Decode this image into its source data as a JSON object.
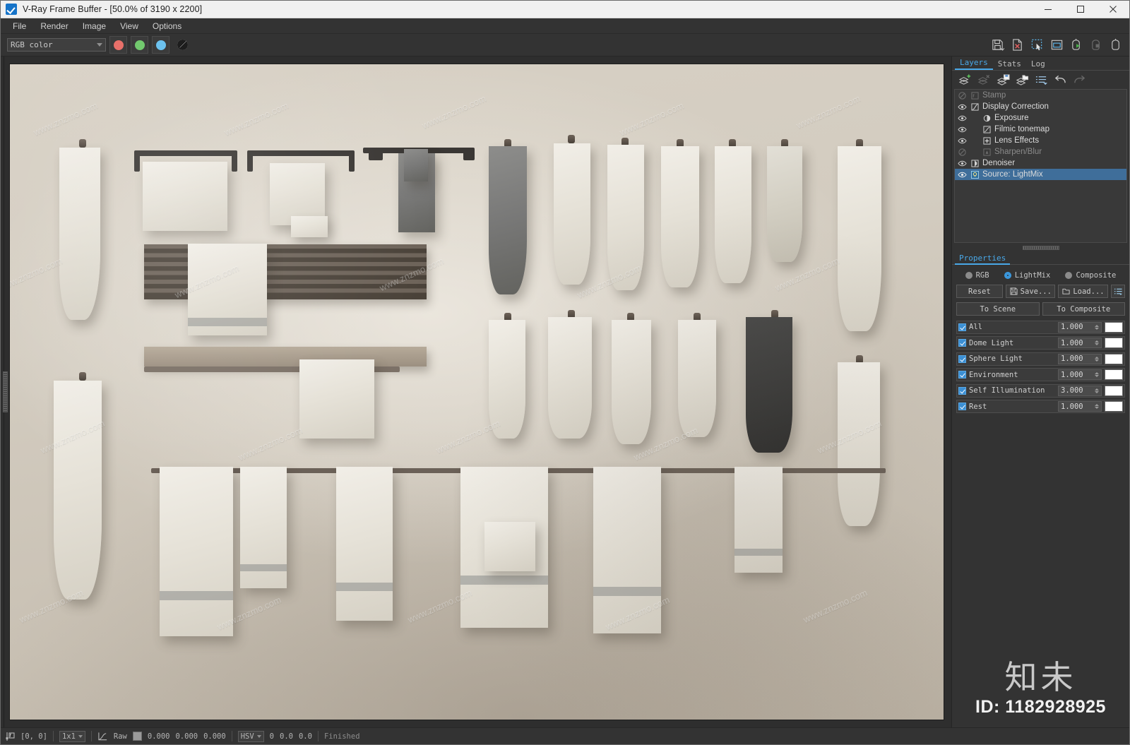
{
  "window": {
    "title": "V-Ray Frame Buffer - [50.0% of 3190 x 2200]",
    "app_icon": "vray-checkbox-icon",
    "minimize": "minimize-icon",
    "maximize": "maximize-icon",
    "close": "close-icon"
  },
  "menu": {
    "items": [
      {
        "label": "File"
      },
      {
        "label": "Render"
      },
      {
        "label": "Image"
      },
      {
        "label": "View"
      },
      {
        "label": "Options"
      }
    ]
  },
  "toolbar": {
    "channel_select": {
      "value": "RGB color"
    },
    "channels": [
      {
        "name": "red-channel-button",
        "color": "#e8706a"
      },
      {
        "name": "green-channel-button",
        "color": "#72c96e"
      },
      {
        "name": "blue-channel-button",
        "color": "#6cc2ef"
      }
    ],
    "alpha_button": "alpha-channel-button",
    "right_icons": [
      {
        "name": "save-image-icon",
        "enabled": true
      },
      {
        "name": "clear-image-icon",
        "enabled": true
      },
      {
        "name": "region-select-icon",
        "enabled": true
      },
      {
        "name": "show-in-window-icon",
        "enabled": true
      },
      {
        "name": "start-render-icon",
        "enabled": true
      },
      {
        "name": "stop-render-icon",
        "enabled": false
      },
      {
        "name": "render-last-icon",
        "enabled": true
      }
    ]
  },
  "layers_panel": {
    "tabs": [
      {
        "label": "Layers",
        "active": true
      },
      {
        "label": "Stats",
        "active": false
      },
      {
        "label": "Log",
        "active": false
      }
    ],
    "toolbar": [
      {
        "name": "add-layer-icon",
        "enabled": true
      },
      {
        "name": "delete-layer-icon",
        "enabled": false
      },
      {
        "name": "save-layers-icon",
        "enabled": true
      },
      {
        "name": "load-layers-icon",
        "enabled": true
      },
      {
        "name": "layer-presets-icon",
        "enabled": true
      },
      {
        "name": "undo-icon",
        "enabled": true
      },
      {
        "name": "redo-icon",
        "enabled": false
      }
    ],
    "layers": [
      {
        "label": "Stamp",
        "visible": false,
        "indent": 0,
        "selected": false,
        "icon": "stamp-icon"
      },
      {
        "label": "Display Correction",
        "visible": true,
        "indent": 0,
        "selected": false,
        "icon": "curve-icon"
      },
      {
        "label": "Exposure",
        "visible": true,
        "indent": 1,
        "selected": false,
        "icon": "exposure-icon"
      },
      {
        "label": "Filmic tonemap",
        "visible": true,
        "indent": 1,
        "selected": false,
        "icon": "filmic-icon"
      },
      {
        "label": "Lens Effects",
        "visible": true,
        "indent": 1,
        "selected": false,
        "icon": "lens-effects-icon"
      },
      {
        "label": "Sharpen/Blur",
        "visible": false,
        "indent": 1,
        "selected": false,
        "icon": "sharpen-blur-icon"
      },
      {
        "label": "Denoiser",
        "visible": true,
        "indent": 0,
        "selected": false,
        "icon": "denoiser-icon"
      },
      {
        "label": "Source: LightMix",
        "visible": true,
        "indent": 0,
        "selected": true,
        "icon": "lightmix-icon"
      }
    ]
  },
  "properties": {
    "tab_label": "Properties",
    "modes": [
      {
        "label": "RGB",
        "selected": false
      },
      {
        "label": "LightMix",
        "selected": true
      },
      {
        "label": "Composite",
        "selected": false
      }
    ],
    "buttons": {
      "reset": "Reset",
      "save": "Save...",
      "load": "Load...",
      "options": "lightmix-options-icon",
      "to_scene": "To Scene",
      "to_composite": "To Composite"
    },
    "lightmix": [
      {
        "label": "All",
        "checked": true,
        "value": "1.000",
        "color": "#ffffff"
      },
      {
        "label": "Dome Light",
        "checked": true,
        "value": "1.000",
        "color": "#ffffff"
      },
      {
        "label": "Sphere Light",
        "checked": true,
        "value": "1.000",
        "color": "#ffffff"
      },
      {
        "label": "Environment",
        "checked": true,
        "value": "1.000",
        "color": "#ffffff"
      },
      {
        "label": "Self Illumination",
        "checked": true,
        "value": "3.000",
        "color": "#ffffff"
      },
      {
        "label": "Rest",
        "checked": true,
        "value": "1.000",
        "color": "#ffffff"
      }
    ]
  },
  "watermark": {
    "brand": "知未",
    "id": "ID: 1182928925",
    "image_marks": "www.znzmo.com"
  },
  "statusbar": {
    "pixel_icon": "pixel-probe-icon",
    "coords": "[0,  0]",
    "sample_size": "1x1",
    "curve_icon": "color-curve-icon",
    "raw_label": "Raw",
    "raw_swatch": "#9a9a9a",
    "values": [
      "0.000",
      "0.000",
      "0.000"
    ],
    "color_space": "HSV",
    "hsv": [
      "0",
      "0.0",
      "0.0"
    ],
    "state": "Finished"
  }
}
